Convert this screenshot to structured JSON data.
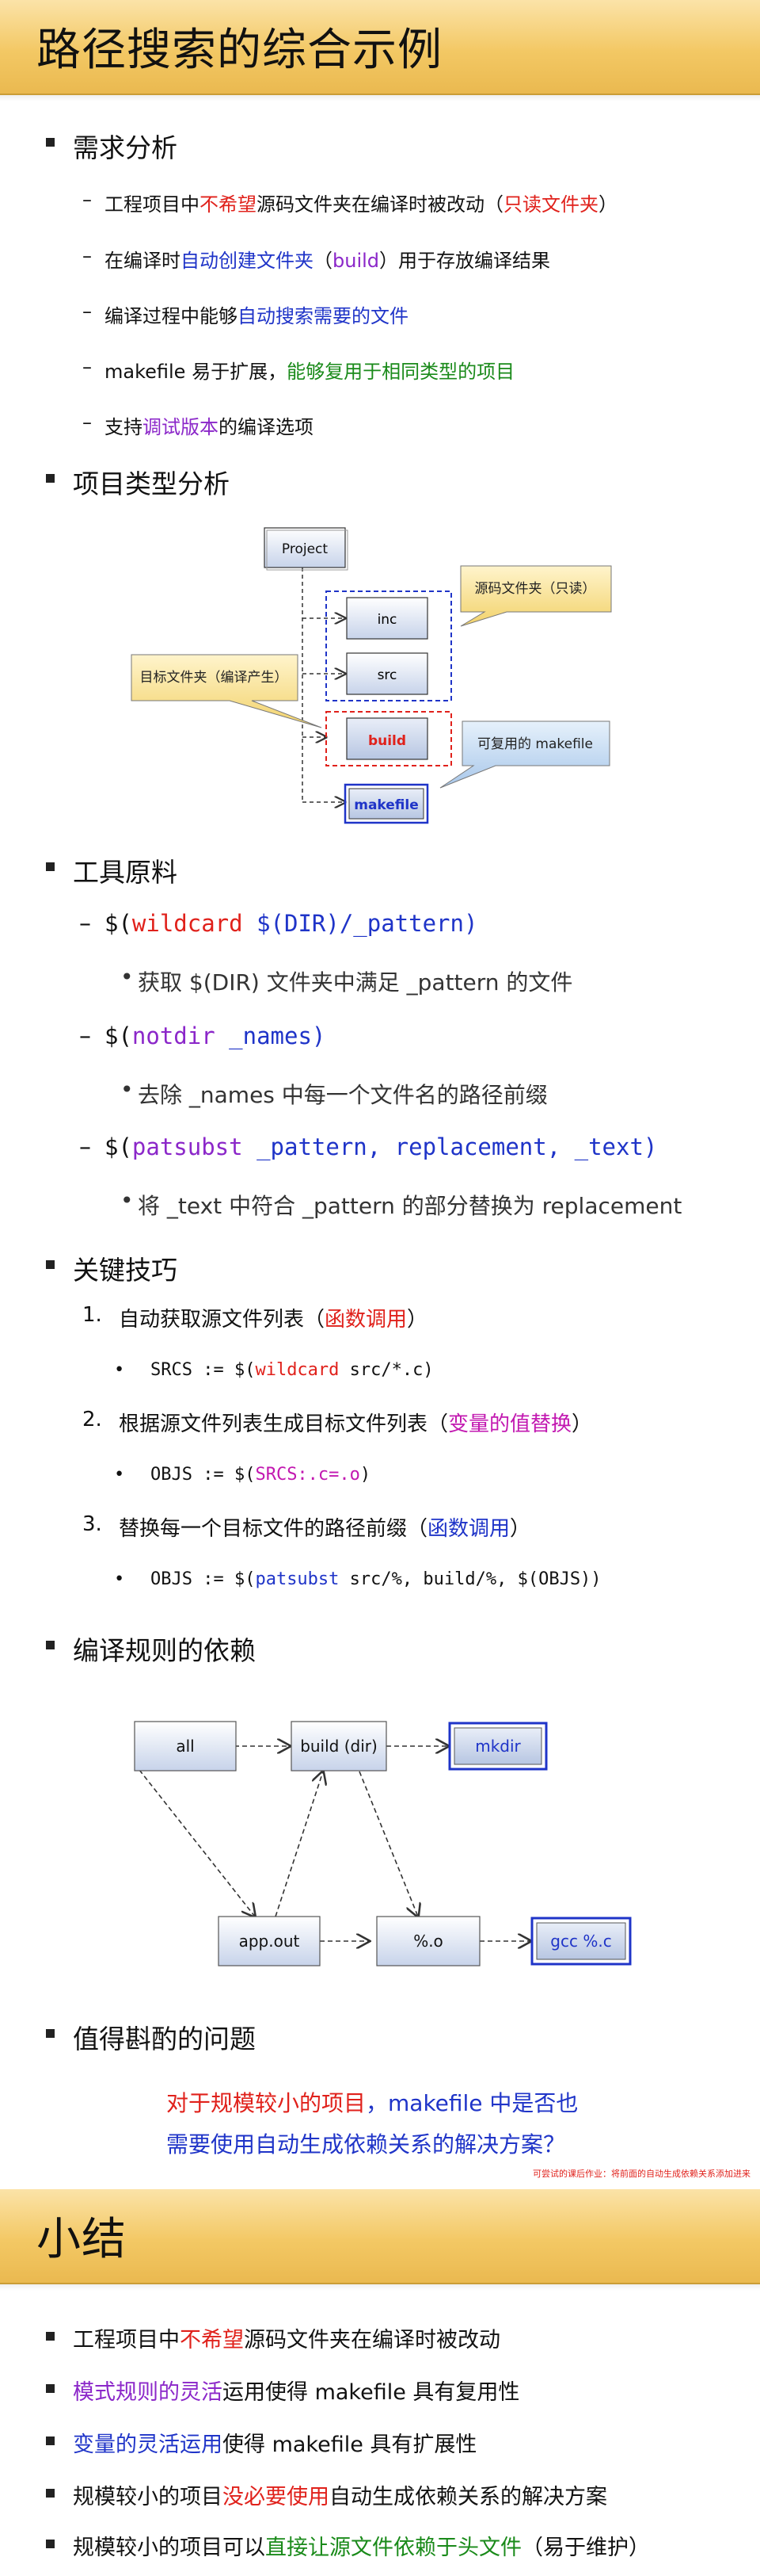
{
  "title": "路径搜索的综合示例",
  "s1": {
    "heading": "需求分析",
    "items": [
      [
        {
          "t": "工程项目中"
        },
        {
          "t": "不希望",
          "c": "red"
        },
        {
          "t": "源码文件夹在编译时被改动（"
        },
        {
          "t": "只读文件夹",
          "c": "red"
        },
        {
          "t": "）"
        }
      ],
      [
        {
          "t": "在编译时"
        },
        {
          "t": "自动创建文件夹",
          "c": "blue"
        },
        {
          "t": "（"
        },
        {
          "t": "build",
          "c": "purple"
        },
        {
          "t": "）用于存放编译结果"
        }
      ],
      [
        {
          "t": "编译过程中能够"
        },
        {
          "t": "自动搜索需要的文件",
          "c": "blue"
        }
      ],
      [
        {
          "t": "makefile 易于扩展，"
        },
        {
          "t": "能够复用于相同类型的项目",
          "c": "green"
        }
      ],
      [
        {
          "t": "支持"
        },
        {
          "t": "调试版本",
          "c": "purple"
        },
        {
          "t": "的编译选项"
        }
      ]
    ]
  },
  "s2": {
    "heading": "项目类型分析",
    "diagram": {
      "project": "Project",
      "inc": "inc",
      "src": "src",
      "build": "build",
      "makefile": "makefile",
      "callout_src": "源码文件夹（只读）",
      "callout_target": "目标文件夹（编译产生）",
      "callout_makefile": "可复用的 makefile"
    }
  },
  "s3": {
    "heading": "工具原料",
    "wildcard": {
      "pre": "$(",
      "fn": "wildcard",
      "arg": " $(DIR)/_pattern)"
    },
    "wildcard_desc": "获取 $(DIR) 文件夹中满足 _pattern 的文件",
    "notdir": {
      "pre": "$(",
      "fn": "notdir",
      "arg": " _names)"
    },
    "notdir_desc": "去除 _names 中每一个文件名的路径前缀",
    "patsubst": {
      "pre": "$(",
      "fn": "patsubst",
      "arg": " _pattern, replacement, _text)"
    },
    "patsubst_desc": "将 _text 中符合 _pattern 的部分替换为 replacement"
  },
  "s4": {
    "heading": "关键技巧",
    "steps": [
      {
        "n": "1.",
        "pre": "自动获取源文件列表（",
        "hl": "函数调用",
        "hlc": "red",
        "post": "）",
        "code": [
          {
            "t": "SRCS := $("
          },
          {
            "t": "wildcard",
            "c": "red"
          },
          {
            "t": " src/*.c)"
          }
        ]
      },
      {
        "n": "2.",
        "pre": "根据源文件列表生成目标文件列表（",
        "hl": "变量的值替换",
        "hlc": "magenta",
        "post": "）",
        "code": [
          {
            "t": "OBJS := $("
          },
          {
            "t": "SRCS:.c=.o",
            "c": "magenta"
          },
          {
            "t": ")"
          }
        ]
      },
      {
        "n": "3.",
        "pre": "替换每一个目标文件的路径前缀（",
        "hl": "函数调用",
        "hlc": "blue",
        "post": "）",
        "code": [
          {
            "t": "OBJS := $("
          },
          {
            "t": "patsubst",
            "c": "blue"
          },
          {
            "t": " src/%, build/%, $(OBJS))"
          }
        ]
      }
    ]
  },
  "s5": {
    "heading": "编译规则的依赖",
    "diagram": {
      "all": "all",
      "build_dir": "build (dir)",
      "mkdir": "mkdir",
      "appout": "app.out",
      "percent_o": "%.o",
      "gcc": "gcc %.c"
    }
  },
  "s6": {
    "heading": "值得斟酌的问题",
    "line1": [
      {
        "t": "对于规模较小的项目",
        "c": "red"
      },
      {
        "t": "，makefile 中是否也",
        "c": "blue"
      }
    ],
    "line2": "需要使用自动生成依赖关系的解决方案？",
    "footnote": "可尝试的课后作业：将前面的自动生成依赖关系添加进来"
  },
  "summary": {
    "title": "小结",
    "items": [
      [
        {
          "t": "工程项目中"
        },
        {
          "t": "不希望",
          "c": "red"
        },
        {
          "t": "源码文件夹在编译时被改动"
        }
      ],
      [
        {
          "t": "模式规则的灵活",
          "c": "purple"
        },
        {
          "t": "运用使得 makefile 具有复用性"
        }
      ],
      [
        {
          "t": "变量的灵活运用",
          "c": "blue"
        },
        {
          "t": "使得 makefile 具有扩展性"
        }
      ],
      [
        {
          "t": "规模较小的项目"
        },
        {
          "t": "没必要使用",
          "c": "red"
        },
        {
          "t": "自动生成依赖关系的解决方案"
        }
      ],
      [
        {
          "t": "规模较小的项目可以"
        },
        {
          "t": "直接让源文件依赖于头文件",
          "c": "green"
        },
        {
          "t": "（易于维护）"
        }
      ]
    ]
  }
}
